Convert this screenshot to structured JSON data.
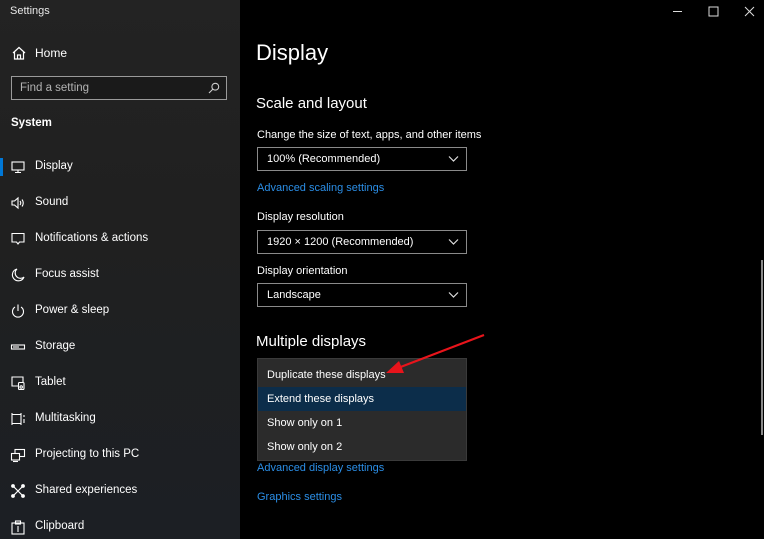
{
  "window": {
    "title": "Settings",
    "controls": {
      "minimize": "minimize",
      "maximize": "maximize",
      "close": "close"
    }
  },
  "sidebar": {
    "home_label": "Home",
    "search": {
      "value": "",
      "placeholder": "Find a setting"
    },
    "section": "System",
    "items": [
      {
        "label": "Display",
        "icon": "monitor-icon",
        "active": true
      },
      {
        "label": "Sound",
        "icon": "speaker-icon",
        "active": false
      },
      {
        "label": "Notifications & actions",
        "icon": "notification-icon",
        "active": false
      },
      {
        "label": "Focus assist",
        "icon": "moon-icon",
        "active": false
      },
      {
        "label": "Power & sleep",
        "icon": "power-icon",
        "active": false
      },
      {
        "label": "Storage",
        "icon": "storage-icon",
        "active": false
      },
      {
        "label": "Tablet",
        "icon": "tablet-icon",
        "active": false
      },
      {
        "label": "Multitasking",
        "icon": "multitasking-icon",
        "active": false
      },
      {
        "label": "Projecting to this PC",
        "icon": "projecting-icon",
        "active": false
      },
      {
        "label": "Shared experiences",
        "icon": "shared-experiences-icon",
        "active": false
      },
      {
        "label": "Clipboard",
        "icon": "clipboard-icon",
        "active": false
      }
    ]
  },
  "main": {
    "title": "Display",
    "scale_section": {
      "heading": "Scale and layout",
      "scale_label": "Change the size of text, apps, and other items",
      "scale_value": "100% (Recommended)",
      "advanced_scaling_link": "Advanced scaling settings",
      "resolution_label": "Display resolution",
      "resolution_value": "1920 × 1200 (Recommended)",
      "orientation_label": "Display orientation",
      "orientation_value": "Landscape"
    },
    "multiple_displays": {
      "heading": "Multiple displays",
      "options": [
        {
          "label": "Duplicate these displays",
          "selected": false
        },
        {
          "label": "Extend these displays",
          "selected": true
        },
        {
          "label": "Show only on 1",
          "selected": false
        },
        {
          "label": "Show only on 2",
          "selected": false
        }
      ],
      "advanced_display_link": "Advanced display settings",
      "graphics_link": "Graphics settings"
    }
  },
  "annotation": {
    "type": "arrow",
    "color": "#e8141b",
    "points_to": "Duplicate these displays"
  },
  "colors": {
    "accent": "#0078d7",
    "link": "#2b8ee6",
    "selected_option": "#0c2d4a"
  }
}
